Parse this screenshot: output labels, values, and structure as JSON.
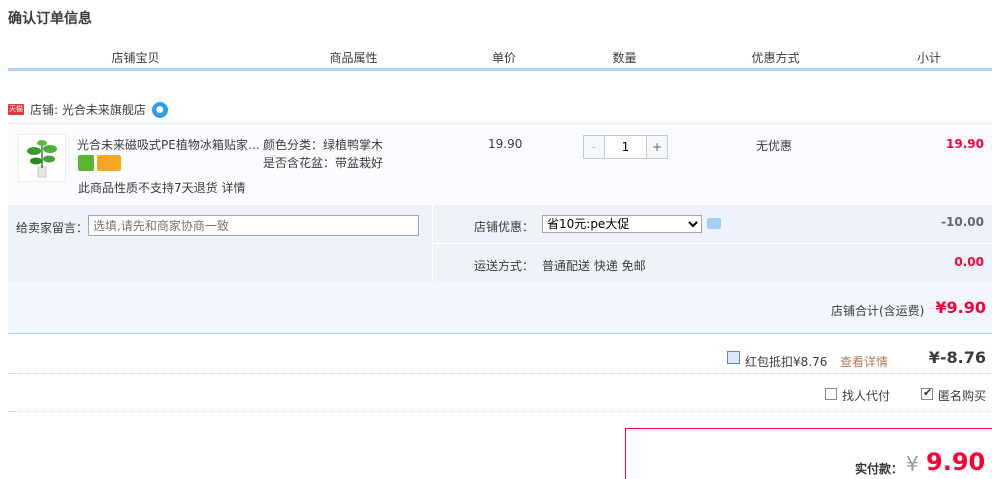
{
  "page_title": "确认订单信息",
  "columns": [
    "店铺宝贝",
    "商品属性",
    "单价",
    "数量",
    "优惠方式",
    "小计"
  ],
  "shop": {
    "badge": "天猫",
    "label": "店铺: 光合未来旗舰店"
  },
  "item": {
    "title": "光合未来磁吸式PE植物冰箱贴家居装饰",
    "attr_color": "颜色分类：绿植鸭掌木",
    "attr_pot": "是否含花盆：带盆栽好",
    "no_return": "此商品性质不支持7天退货 详情",
    "price": "19.90",
    "quantity": "1",
    "qty_minus": "-",
    "qty_plus": "+",
    "discount": "无优惠",
    "subtotal": "19.90"
  },
  "note": {
    "label": "给卖家留言：",
    "placeholder": "选填,请先和商家协商一致"
  },
  "shop_discount": {
    "label": "店铺优惠：",
    "selected": "省10元:pe大促",
    "value": "-10.00"
  },
  "shipping": {
    "label": "运送方式：",
    "method": "普通配送 快递 免邮",
    "fee": "0.00"
  },
  "shop_total": {
    "label": "店铺合计(含运费)",
    "value": "¥9.90"
  },
  "red_packet": {
    "label": "红包抵扣¥8.76",
    "detail_link": "查看详情",
    "value": "¥-8.76"
  },
  "options": {
    "proxy_pay": "找人代付",
    "anonymous": "匿名购买"
  },
  "payment": {
    "label": "实付款：",
    "yen": "¥",
    "value": "9.90"
  },
  "colors": {
    "accent_red": "#ff0036",
    "header_line": "#b2d1ff",
    "row_bg": "#eef3fb"
  }
}
